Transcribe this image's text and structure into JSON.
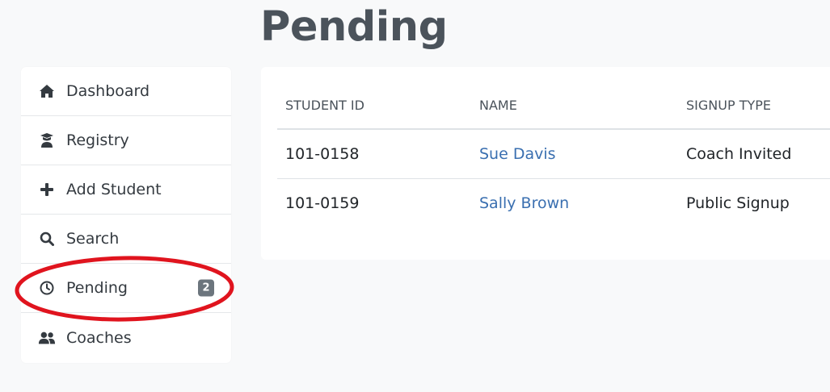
{
  "page": {
    "title": "Pending"
  },
  "sidebar": {
    "items": [
      {
        "label": "Dashboard",
        "icon": "home-icon"
      },
      {
        "label": "Registry",
        "icon": "user-graduate-icon"
      },
      {
        "label": "Add Student",
        "icon": "plus-icon"
      },
      {
        "label": "Search",
        "icon": "search-icon"
      },
      {
        "label": "Pending",
        "icon": "clock-icon",
        "badge": "2"
      },
      {
        "label": "Coaches",
        "icon": "users-icon"
      }
    ]
  },
  "table": {
    "headers": [
      "STUDENT ID",
      "NAME",
      "SIGNUP TYPE"
    ],
    "rows": [
      {
        "student_id": "101-0158",
        "name": "Sue Davis",
        "signup_type": "Coach Invited"
      },
      {
        "student_id": "101-0159",
        "name": "Sally Brown",
        "signup_type": "Public Signup"
      }
    ]
  },
  "colors": {
    "background": "#f8f9fa",
    "link": "#3a6fb0",
    "badge": "#6c757d",
    "annotation": "#e0141e"
  }
}
